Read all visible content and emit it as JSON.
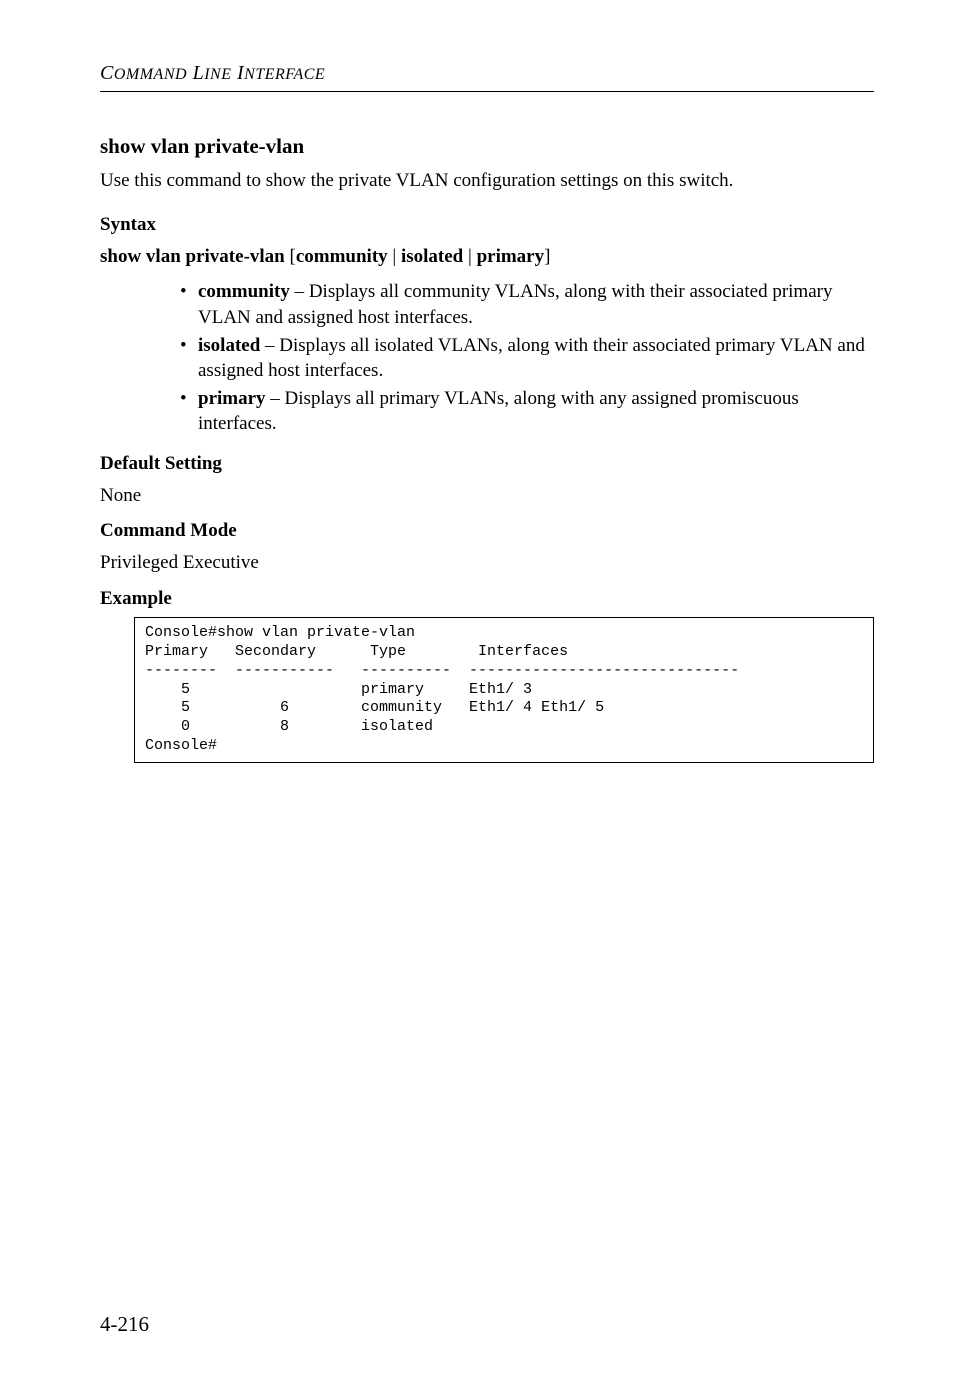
{
  "header": {
    "running_title_1": "C",
    "running_title_2": "OMMAND",
    "running_title_3": " L",
    "running_title_4": "INE",
    "running_title_5": " I",
    "running_title_6": "NTERFACE"
  },
  "section": {
    "title": "show vlan private-vlan",
    "intro": "Use this command to show the private VLAN configuration settings on this switch."
  },
  "syntax": {
    "heading": "Syntax",
    "line_prefix": "show vlan private-vlan",
    "line_middle": " [",
    "opt1": "community",
    "sep": " | ",
    "opt2": "isolated",
    "opt3": "primary",
    "line_suffix": "]"
  },
  "options": {
    "community_label": "community",
    "community_text": " – Displays all community VLANs, along with their associated primary VLAN and assigned host interfaces.",
    "isolated_label": "isolated",
    "isolated_text": " – Displays all isolated VLANs, along with their associated primary VLAN and assigned host interfaces.",
    "primary_label": "primary",
    "primary_text": " – Displays all primary VLANs, along with any assigned promiscuous interfaces."
  },
  "default_setting": {
    "heading": "Default Setting",
    "value": "None"
  },
  "command_mode": {
    "heading": "Command Mode",
    "value": "Privileged Executive"
  },
  "example": {
    "heading": "Example",
    "console": "Console#show vlan private-vlan\nPrimary   Secondary      Type        Interfaces\n--------  -----------   ----------  ------------------------------\n    5                   primary     Eth1/ 3\n    5          6        community   Eth1/ 4 Eth1/ 5\n    0          8        isolated\nConsole#"
  },
  "pagenum": "4-216"
}
